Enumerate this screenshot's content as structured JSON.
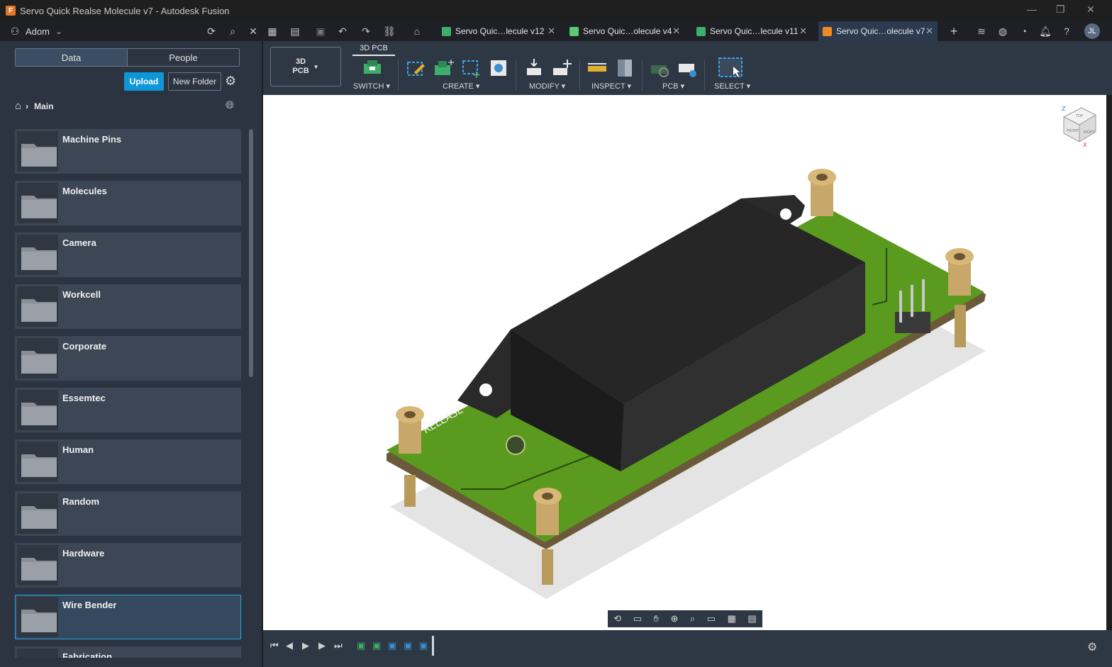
{
  "window": {
    "title": "Servo Quick Realse Molecule v7 - Autodesk Fusion"
  },
  "topbar": {
    "team": "Adom",
    "user_initials": "JL"
  },
  "tabs": [
    {
      "label": "Servo Quic…lecule v12",
      "color": "#3fae6a",
      "active": false
    },
    {
      "label": "Servo Quic…olecule v4",
      "color": "#5cc86f",
      "active": false
    },
    {
      "label": "Servo Quic…lecule v11",
      "color": "#3fae6a",
      "active": false
    },
    {
      "label": "Servo Quic…olecule v7",
      "color": "#f08a24",
      "active": true
    }
  ],
  "data_panel": {
    "seg_data": "Data",
    "seg_people": "People",
    "upload_label": "Upload",
    "new_folder_label": "New Folder",
    "breadcrumb": "Main",
    "folders": [
      "Machine Pins",
      "Molecules",
      "Camera",
      "Workcell",
      "Corporate",
      "Essemtec",
      "Human",
      "Random",
      "Hardware",
      "Wire Bender",
      "Fabrication"
    ],
    "selected_folder": "Wire Bender"
  },
  "toolbar": {
    "workspace_line1": "3D",
    "workspace_line2": "PCB",
    "ribbon_tab": "3D PCB",
    "groups": [
      "SWITCH",
      "CREATE",
      "MODIFY",
      "INSPECT",
      "PCB",
      "SELECT"
    ]
  },
  "pcb": {
    "silkscreen": "RELEASE",
    "board_color": "#5a9a1e",
    "part_color": "#1e1e1e",
    "pin_color": "#c8a86a"
  },
  "viewcube": {
    "top": "TOP",
    "front": "FRONT",
    "right": "RIGHT",
    "axis_z": "Z",
    "axis_x": "X"
  }
}
